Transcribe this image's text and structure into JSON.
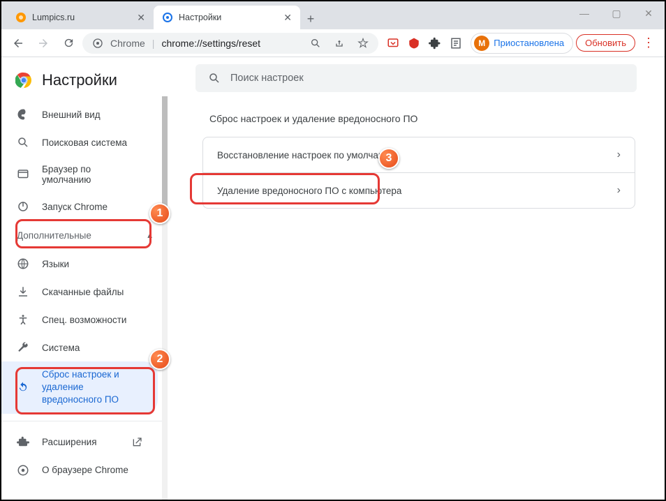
{
  "window": {
    "tabs": [
      {
        "title": "Lumpics.ru",
        "active": false
      },
      {
        "title": "Настройки",
        "active": true
      }
    ],
    "profile_initial": "М",
    "profile_label": "Приостановлена",
    "update_label": "Обновить"
  },
  "omnibox": {
    "prefix": "Chrome",
    "url": "chrome://settings/reset"
  },
  "sidebar": {
    "title": "Настройки",
    "items_top": [
      {
        "label": "Внешний вид"
      },
      {
        "label": "Поисковая система"
      },
      {
        "label": "Браузер по умолчанию"
      },
      {
        "label": "Запуск Chrome"
      }
    ],
    "advanced_label": "Дополнительные",
    "items_adv": [
      {
        "label": "Языки"
      },
      {
        "label": "Скачанные файлы"
      },
      {
        "label": "Спец. возможности"
      },
      {
        "label": "Система"
      },
      {
        "label": "Сброс настроек и удаление вредоносного ПО"
      }
    ],
    "items_bottom": [
      {
        "label": "Расширения"
      },
      {
        "label": "О браузере Chrome"
      }
    ]
  },
  "main": {
    "search_placeholder": "Поиск настроек",
    "section_title": "Сброс настроек и удаление вредоносного ПО",
    "rows": [
      {
        "label": "Восстановление настроек по умолчанию"
      },
      {
        "label": "Удаление вредоносного ПО с компьютера"
      }
    ]
  },
  "annotations": {
    "b1": "1",
    "b2": "2",
    "b3": "3"
  }
}
